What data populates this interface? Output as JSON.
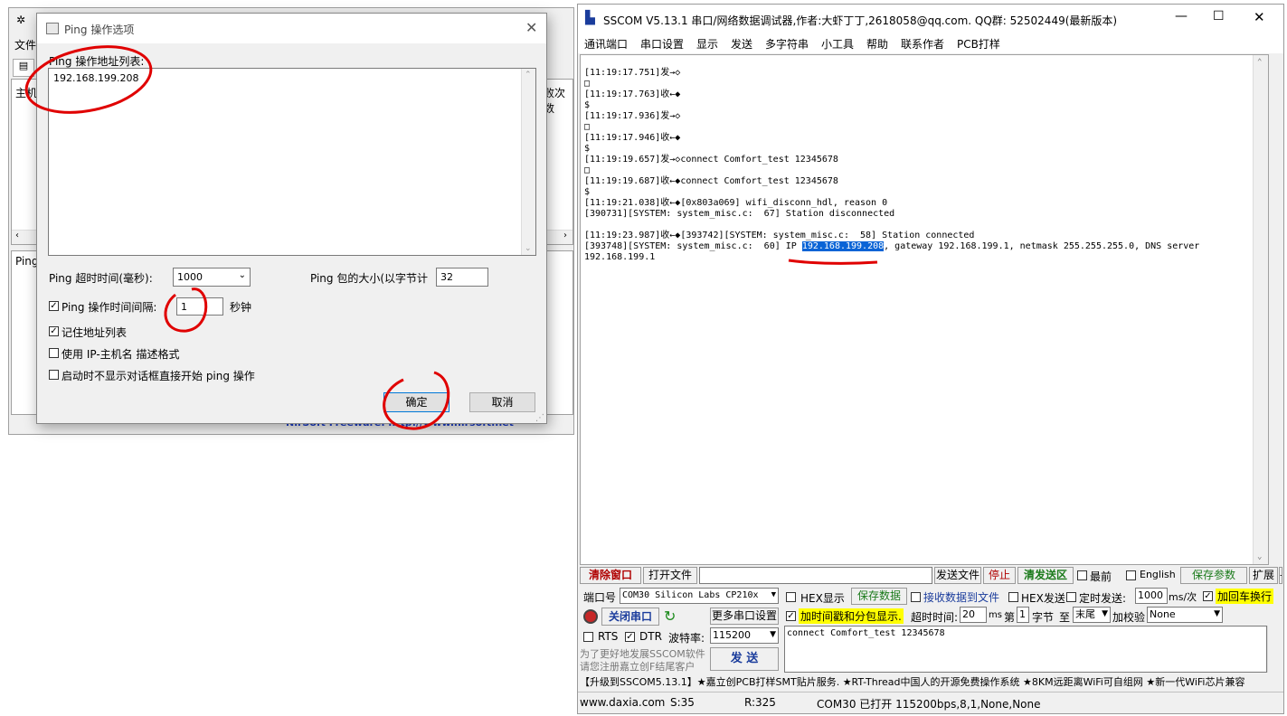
{
  "bg_window": {
    "menu_file": "文件",
    "host_label": "主机",
    "col_fail": "败次数",
    "ping_label": "Ping",
    "footer_link": "NirSoft Freeware.  http://www.nirsoft.net"
  },
  "ping_dialog": {
    "title": "Ping 操作选项",
    "address_list_label": "Ping 操作地址列表:",
    "address_list_value": "192.168.199.208",
    "timeout_label": "Ping 超时时间(毫秒):",
    "timeout_value": "1000",
    "packet_size_label": "Ping 包的大小(以字节计",
    "packet_size_value": "32",
    "interval_label": "Ping 操作时间间隔:",
    "interval_checked": true,
    "interval_value": "1",
    "interval_unit": "秒钟",
    "remember_label": "记住地址列表",
    "remember_checked": true,
    "ip_host_label": "使用 IP-主机名 描述格式",
    "ip_host_checked": false,
    "autostart_label": "启动时不显示对话框直接开始 ping 操作",
    "autostart_checked": false,
    "ok_label": "确定",
    "cancel_label": "取消"
  },
  "sscom": {
    "title": "SSCOM V5.13.1 串口/网络数据调试器,作者:大虾丁丁,2618058@qq.com. QQ群: 52502449(最新版本)",
    "menu": [
      "通讯端口",
      "串口设置",
      "显示",
      "发送",
      "多字符串",
      "小工具",
      "帮助",
      "联系作者",
      "PCB打样"
    ],
    "log": [
      "[11:19:17.751]发→◇",
      "□",
      "[11:19:17.763]收←◆",
      "$",
      "[11:19:17.936]发→◇",
      "□",
      "[11:19:17.946]收←◆",
      "$",
      "[11:19:19.657]发→◇connect Comfort_test 12345678",
      "□",
      "[11:19:19.687]收←◆connect Comfort_test 12345678",
      "$",
      "[11:19:21.038]收←◆[0x803a069] wifi_disconn_hdl, reason 0",
      "[390731][SYSTEM: system_misc.c:  67] Station disconnected",
      "",
      "[11:19:23.987]收←◆[393742][SYSTEM: system_misc.c:  58] Station connected"
    ],
    "log_ip_prefix": "[393748][SYSTEM: system_misc.c:  60] IP ",
    "log_ip_value": "192.168.199.208",
    "log_ip_suffix": ", gateway 192.168.199.1, netmask 255.255.255.0, DNS server",
    "log_last": "192.168.199.1",
    "btn_clear_window": "清除窗口",
    "btn_open_file": "打开文件",
    "btn_send_file": "发送文件",
    "btn_stop": "停止",
    "btn_clear_send": "清发送区",
    "chk_top": "最前",
    "chk_english": "English",
    "btn_save_params": "保存参数",
    "btn_expand": "扩展",
    "btn_minus": "—",
    "port_label": "端口号",
    "port_value": "COM30 Silicon Labs CP210x",
    "chk_hex_display": "HEX显示",
    "btn_save_data": "保存数据",
    "chk_recv_to_file": "接收数据到文件",
    "chk_hex_send": "HEX发送",
    "chk_timed_send": "定时发送:",
    "timed_value": "1000",
    "timed_unit": "ms/次",
    "chk_add_crlf": "加回车换行",
    "btn_close_port": "关闭串口",
    "btn_more_settings": "更多串口设置",
    "chk_timestamp": "加时间戳和分包显示.",
    "timeout_label": "超时时间:",
    "timeout_value": "20",
    "timeout_unit": "ms",
    "byte_label_1": "第",
    "byte_value": "1",
    "byte_label_2": "字节",
    "byte_to": "至",
    "byte_end": "末尾",
    "checksum_label": "加校验",
    "checksum_value": "None",
    "chk_rts": "RTS",
    "chk_dtr": "DTR",
    "baud_label": "波特率:",
    "baud_value": "115200",
    "send_text": "connect Comfort_test 12345678",
    "promo_1": "为了更好地发展SSCOM软件",
    "promo_2": "请您注册嘉立创F结尾客户",
    "btn_send": "发 送",
    "ticker": "【升级到SSCOM5.13.1】★嘉立创PCB打样SMT贴片服务. ★RT-Thread中国人的开源免费操作系统 ★8KM远距离WiFi可自组网 ★新一代WiFi芯片兼容",
    "status_site": "www.daxia.com",
    "status_s": "S:35",
    "status_r": "R:325",
    "status_port": "COM30 已打开  115200bps,8,1,None,None"
  },
  "colors": {
    "annotation_red": "#e00000",
    "highlight_blue": "#0a64d6"
  }
}
